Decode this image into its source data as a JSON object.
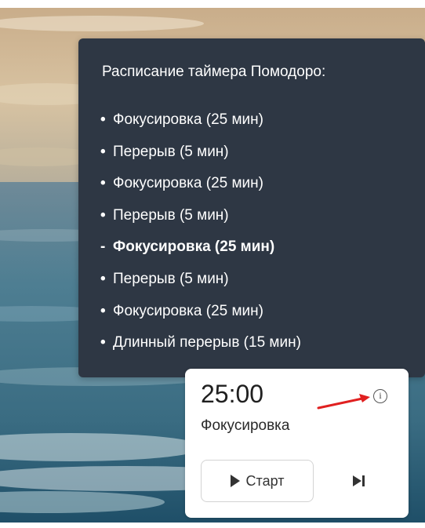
{
  "tooltip": {
    "title": "Расписание таймера Помодоро:",
    "items": [
      {
        "bullet": "•",
        "label": "Фокусировка (25 мин)"
      },
      {
        "bullet": "•",
        "label": "Перерыв (5 мин)"
      },
      {
        "bullet": "•",
        "label": "Фокусировка (25 мин)"
      },
      {
        "bullet": "•",
        "label": "Перерыв (5 мин)"
      },
      {
        "bullet": "-",
        "label": "Фокусировка (25 мин)"
      },
      {
        "bullet": "•",
        "label": "Перерыв (5 мин)"
      },
      {
        "bullet": "•",
        "label": "Фокусировка (25 мин)"
      },
      {
        "bullet": "•",
        "label": "Длинный перерыв (15 мин)"
      }
    ],
    "current_index": 4,
    "background_color": "#2e3744"
  },
  "timer": {
    "time": "25:00",
    "phase_label": "Фокусировка",
    "info_icon": "info-icon",
    "info_glyph": "i",
    "start_label": "Старт",
    "start_icon": "play-icon",
    "skip_icon": "skip-next-icon"
  },
  "annotation": {
    "arrow_color": "#e02020",
    "arrow_icon": "annotation-arrow"
  }
}
